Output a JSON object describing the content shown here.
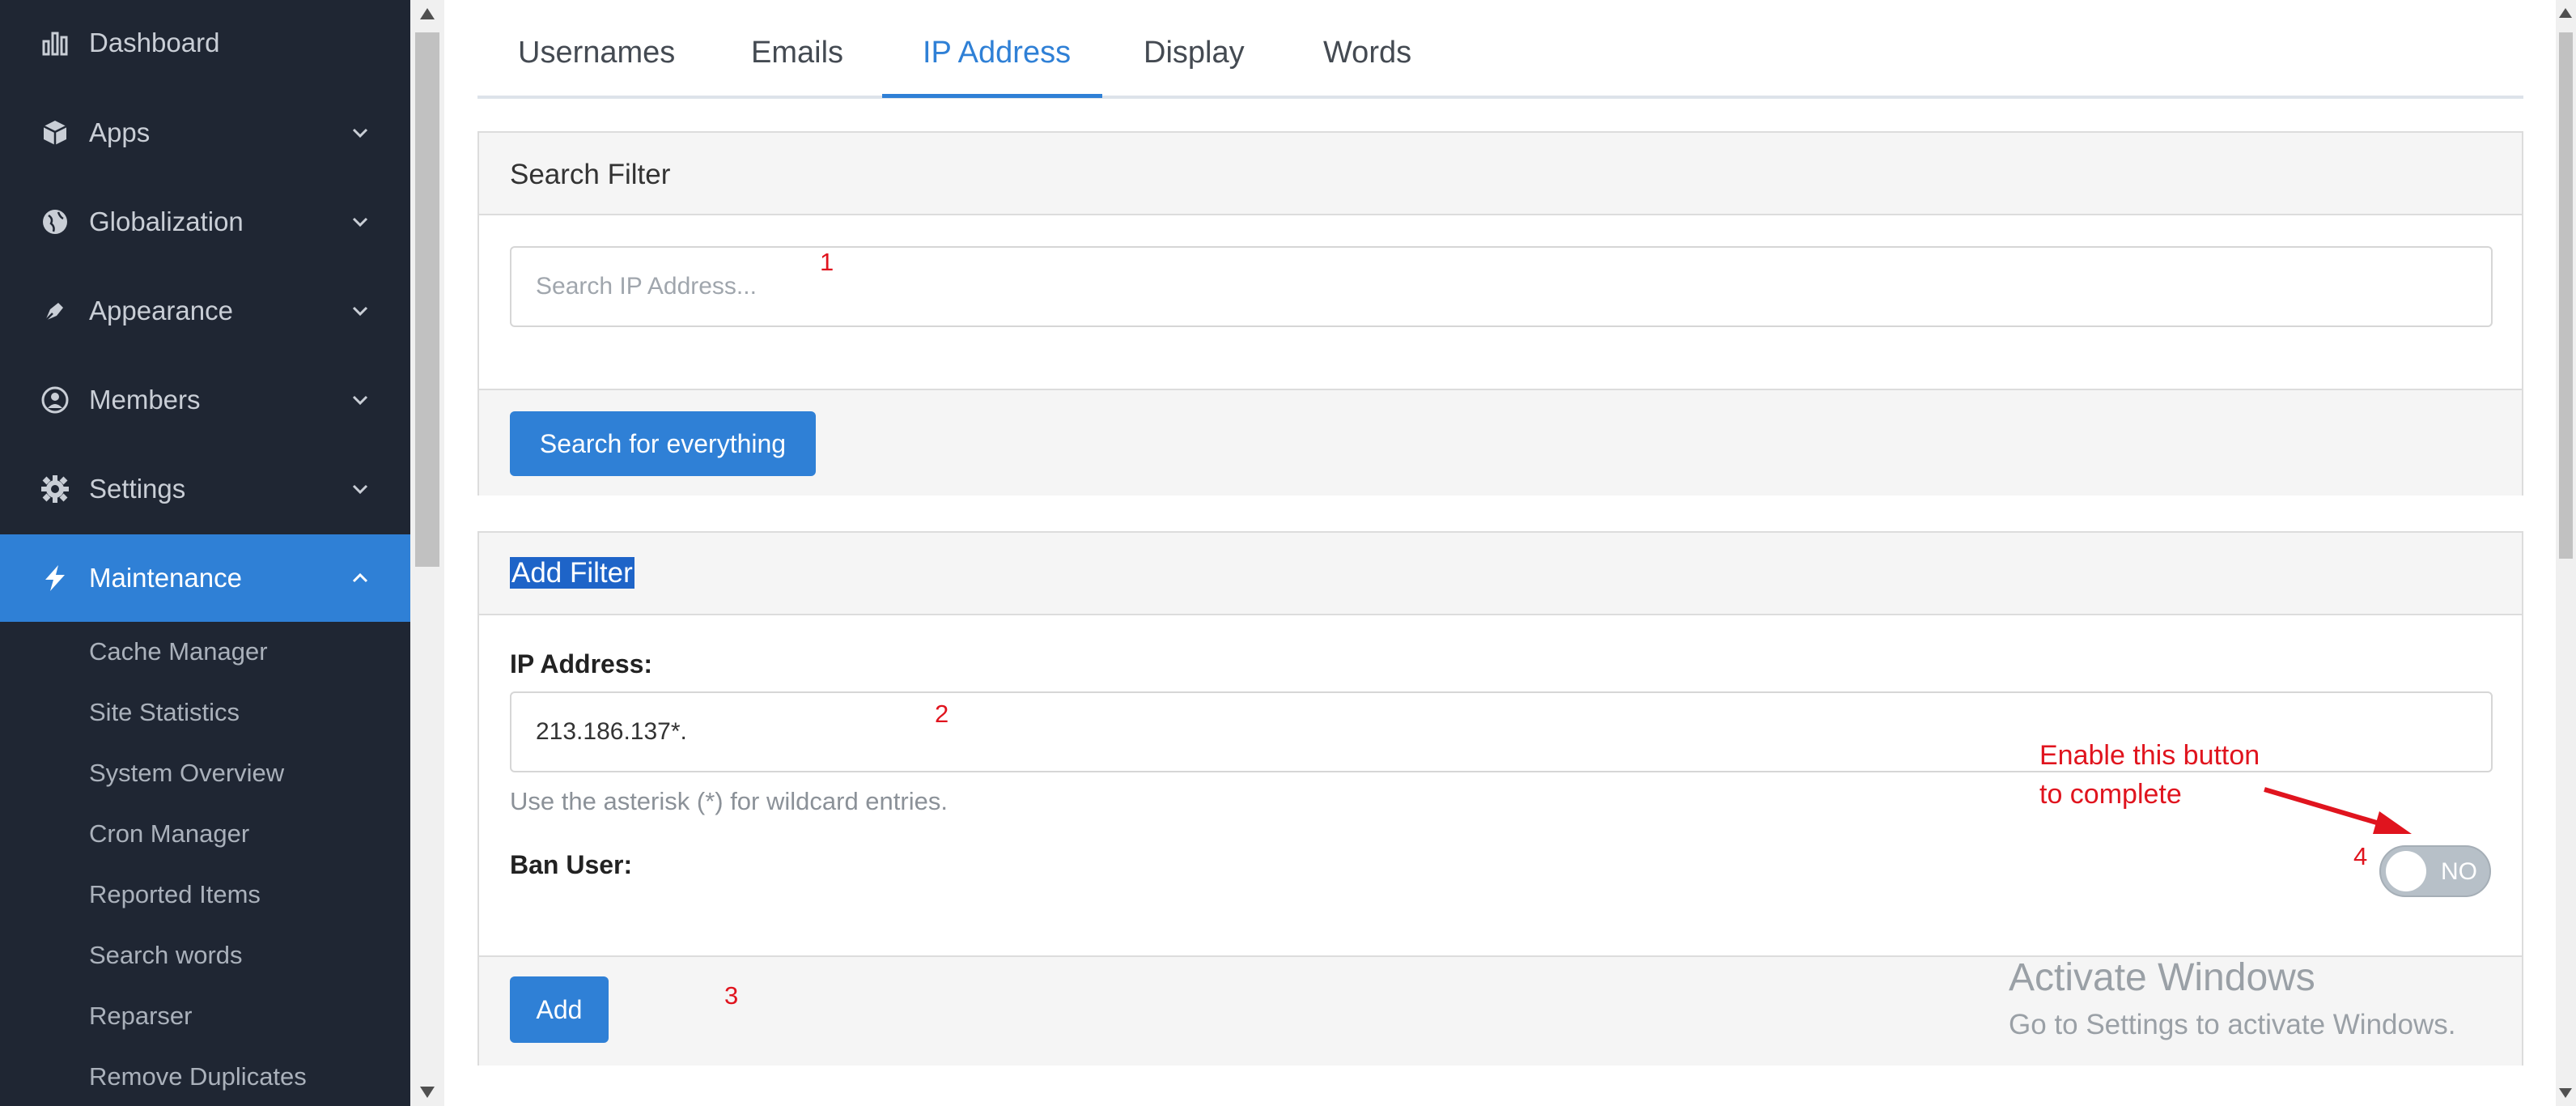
{
  "sidebar": {
    "items": [
      {
        "label": "Dashboard",
        "icon": "bar-chart-icon",
        "chevron": ""
      },
      {
        "label": "Apps",
        "icon": "cube-icon",
        "chevron": "down"
      },
      {
        "label": "Globalization",
        "icon": "globe-icon",
        "chevron": "down"
      },
      {
        "label": "Appearance",
        "icon": "pen-icon",
        "chevron": "down"
      },
      {
        "label": "Members",
        "icon": "user-circle-icon",
        "chevron": "down"
      },
      {
        "label": "Settings",
        "icon": "gear-icon",
        "chevron": "down"
      },
      {
        "label": "Maintenance",
        "icon": "bolt-icon",
        "chevron": "up",
        "active": true
      }
    ],
    "subitems": [
      "Cache Manager",
      "Site Statistics",
      "System Overview",
      "Cron Manager",
      "Reported Items",
      "Search words",
      "Reparser",
      "Remove Duplicates"
    ]
  },
  "tabs": [
    {
      "label": "Usernames"
    },
    {
      "label": "Emails"
    },
    {
      "label": "IP Address",
      "active": true
    },
    {
      "label": "Display"
    },
    {
      "label": "Words"
    }
  ],
  "search_panel": {
    "title": "Search Filter",
    "placeholder": "Search IP Address...",
    "button": "Search for everything"
  },
  "add_panel": {
    "title": "Add Filter",
    "ip_label": "IP Address:",
    "ip_value": "213.186.137*.",
    "help": "Use the asterisk (*) for wildcard entries.",
    "ban_label": "Ban User:",
    "toggle_text": "NO",
    "button": "Add"
  },
  "annotations": {
    "a1": "1",
    "a2": "2",
    "a3": "3",
    "a4": "4",
    "note_line1": "Enable this button",
    "note_line2": "to complete"
  },
  "watermark": {
    "line1": "Activate Windows",
    "line2": "Go to Settings to activate Windows."
  },
  "colors": {
    "sidebar_bg": "#1f2633",
    "accent": "#2f80d6",
    "annotation": "#e0141e"
  }
}
